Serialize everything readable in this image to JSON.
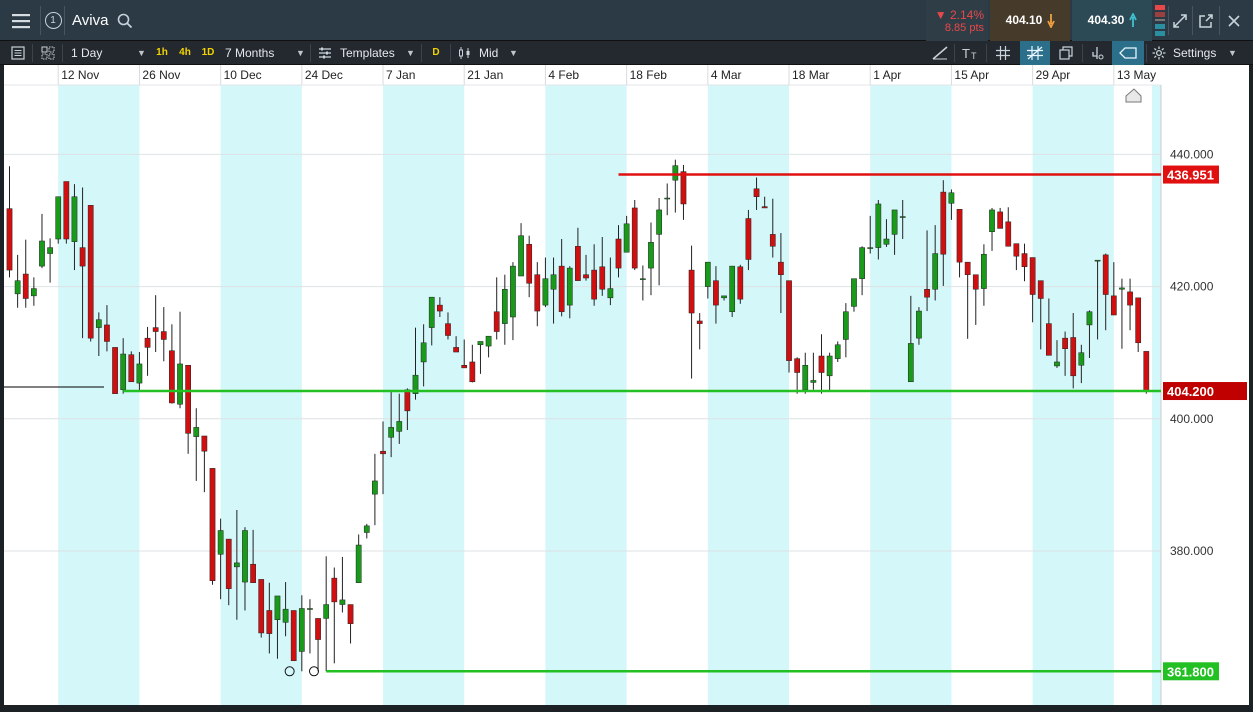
{
  "header": {
    "menu_icon": "hamburger-menu-icon",
    "account_number": "1",
    "instrument": "Aviva",
    "search_icon": "search-icon",
    "change_pct": "▼ 2.14%",
    "change_pts": "8.85 pts",
    "sell_price": "404.10",
    "buy_price": "404.30",
    "controls": [
      "expand-icon",
      "popout-icon",
      "close-icon"
    ]
  },
  "toolbar": {
    "interval": "1 Day",
    "quick_intervals": [
      "1h",
      "4h",
      "1D"
    ],
    "range": "7 Months",
    "templates": "Templates",
    "chart_type_badge": "D",
    "price_mode": "Mid",
    "drawing_label_icon": "text-size-icon",
    "settings": "Settings"
  },
  "chart_data": {
    "type": "candlestick",
    "instrument": "Aviva",
    "interval": "1 Day",
    "x_tick_labels": [
      "12 Nov",
      "26 Nov",
      "10 Dec",
      "24 Dec",
      "7 Jan",
      "21 Jan",
      "4 Feb",
      "18 Feb",
      "4 Mar",
      "18 Mar",
      "1 Apr",
      "15 Apr",
      "29 Apr",
      "13 May"
    ],
    "y_tick_labels": [
      "440.000",
      "420.000",
      "400.000",
      "380.000"
    ],
    "y_ticks": [
      440,
      420,
      400,
      380
    ],
    "ylim": [
      356.7,
      450.5
    ],
    "grid": true,
    "alternating_week_shading": true,
    "current_price": 404.2,
    "current_price_label": "404.200",
    "horizontal_lines": [
      {
        "label": "436.951",
        "value": 436.951,
        "color": "#e01010",
        "start_index": 75
      },
      {
        "label": "404.200",
        "value": 404.2,
        "color": "#22c022",
        "start_index": 14
      },
      {
        "label": "361.800",
        "value": 361.8,
        "color": "#22c022",
        "start_index": 39
      }
    ],
    "ohlc": [
      [
        431.8,
        438.2,
        421.4,
        422.5
      ],
      [
        418.9,
        424.8,
        416.8,
        420.9
      ],
      [
        421.9,
        427.1,
        416.8,
        418.2
      ],
      [
        418.6,
        421.4,
        417.1,
        419.7
      ],
      [
        423.1,
        431.0,
        422.8,
        426.9
      ],
      [
        425.0,
        427.3,
        420.6,
        425.9
      ],
      [
        427.2,
        433.6,
        426.5,
        433.6
      ],
      [
        435.9,
        435.9,
        426.5,
        427.2
      ],
      [
        426.8,
        435.5,
        422.5,
        433.6
      ],
      [
        425.9,
        435.0,
        412.2,
        423.1
      ],
      [
        432.3,
        432.3,
        411.7,
        412.2
      ],
      [
        413.8,
        416.1,
        409.5,
        415.0
      ],
      [
        414.2,
        417.2,
        410.2,
        411.7
      ],
      [
        410.8,
        410.8,
        404.4,
        403.8
      ],
      [
        404.4,
        412.2,
        403.8,
        409.8
      ],
      [
        409.7,
        410.2,
        405.6,
        405.6
      ],
      [
        405.4,
        410.1,
        404.1,
        408.3
      ],
      [
        412.2,
        413.9,
        406.5,
        410.8
      ],
      [
        413.8,
        418.7,
        410.1,
        413.2
      ],
      [
        413.2,
        416.9,
        408.7,
        412.0
      ],
      [
        410.3,
        414.3,
        402.3,
        402.4
      ],
      [
        402.2,
        416.2,
        401.6,
        408.3
      ],
      [
        408.1,
        408.1,
        394.7,
        397.8
      ],
      [
        397.3,
        401.6,
        390.6,
        398.7
      ],
      [
        397.4,
        397.4,
        388.9,
        395.1
      ],
      [
        392.5,
        392.5,
        374.9,
        375.5
      ],
      [
        379.5,
        384.9,
        372.7,
        383.1
      ],
      [
        381.8,
        381.8,
        371.8,
        374.3
      ],
      [
        377.6,
        386.2,
        369.6,
        378.2
      ],
      [
        375.3,
        383.6,
        371.0,
        383.1
      ],
      [
        378.0,
        383.2,
        375.5,
        375.2
      ],
      [
        375.7,
        375.7,
        366.9,
        367.6
      ],
      [
        371.0,
        375.2,
        364.5,
        367.5
      ],
      [
        369.6,
        373.1,
        363.7,
        373.2
      ],
      [
        369.2,
        375.3,
        367.1,
        371.2
      ],
      [
        371.0,
        371.0,
        364.7,
        363.4
      ],
      [
        364.8,
        373.3,
        361.8,
        371.3
      ],
      [
        371.2,
        372.7,
        364.5,
        371.3
      ],
      [
        369.8,
        369.8,
        361.8,
        366.6
      ],
      [
        369.8,
        379.2,
        361.8,
        371.9
      ],
      [
        375.9,
        377.5,
        363.0,
        372.3
      ],
      [
        371.9,
        379.1,
        370.7,
        372.6
      ],
      [
        371.9,
        371.9,
        366.0,
        369.0
      ],
      [
        375.2,
        382.5,
        375.2,
        380.9
      ],
      [
        382.8,
        384.1,
        381.9,
        383.8
      ],
      [
        388.6,
        394.7,
        383.9,
        390.6
      ],
      [
        395.1,
        399.6,
        388.6,
        394.7
      ],
      [
        397.2,
        404.1,
        394.2,
        398.7
      ],
      [
        398.1,
        403.8,
        396.2,
        399.6
      ],
      [
        404.4,
        404.6,
        398.3,
        401.2
      ],
      [
        403.8,
        413.8,
        402.9,
        406.6
      ],
      [
        408.6,
        414.3,
        404.9,
        411.5
      ],
      [
        413.8,
        418.4,
        411.1,
        418.4
      ],
      [
        417.2,
        418.4,
        415.4,
        416.3
      ],
      [
        414.4,
        416.1,
        412.0,
        412.6
      ],
      [
        410.8,
        412.5,
        410.1,
        410.1
      ],
      [
        408.1,
        412.0,
        408.1,
        407.7
      ],
      [
        408.6,
        411.2,
        405.5,
        405.6
      ],
      [
        411.2,
        411.2,
        406.8,
        411.7
      ],
      [
        411.0,
        412.5,
        409.3,
        412.5
      ],
      [
        416.2,
        421.4,
        412.0,
        413.2
      ],
      [
        414.4,
        421.8,
        411.2,
        419.6
      ],
      [
        415.4,
        423.7,
        411.9,
        423.1
      ],
      [
        421.6,
        429.6,
        421.6,
        427.7
      ],
      [
        426.4,
        427.7,
        418.4,
        420.5
      ],
      [
        421.8,
        423.7,
        414.0,
        416.3
      ],
      [
        417.2,
        424.4,
        416.9,
        421.2
      ],
      [
        419.6,
        424.4,
        414.4,
        421.8
      ],
      [
        423.1,
        427.2,
        415.5,
        416.2
      ],
      [
        417.2,
        423.1,
        415.2,
        422.8
      ],
      [
        426.1,
        428.9,
        421.4,
        420.9
      ],
      [
        421.8,
        424.8,
        420.9,
        421.3
      ],
      [
        422.5,
        426.4,
        417.1,
        418.1
      ],
      [
        423.0,
        427.5,
        418.6,
        419.6
      ],
      [
        418.3,
        424.4,
        417.2,
        419.7
      ],
      [
        427.2,
        429.3,
        421.4,
        422.8
      ],
      [
        425.2,
        430.7,
        425.2,
        429.5
      ],
      [
        431.9,
        433.1,
        422.5,
        422.8
      ],
      [
        421.2,
        423.2,
        417.9,
        421.2
      ],
      [
        422.8,
        429.7,
        418.7,
        426.7
      ],
      [
        427.9,
        433.4,
        420.2,
        431.6
      ],
      [
        433.4,
        435.6,
        430.8,
        433.4
      ],
      [
        436.1,
        439.2,
        431.2,
        438.3
      ],
      [
        437.4,
        438.4,
        430.1,
        432.5
      ],
      [
        422.5,
        426.2,
        406.1,
        416.0
      ],
      [
        414.8,
        416.0,
        410.5,
        414.4
      ],
      [
        420.0,
        423.1,
        418.2,
        423.7
      ],
      [
        420.9,
        423.1,
        414.4,
        417.2
      ],
      [
        418.3,
        418.3,
        417.9,
        418.6
      ],
      [
        416.2,
        420.9,
        415.4,
        423.1
      ],
      [
        423.0,
        423.3,
        417.4,
        418.1
      ],
      [
        430.3,
        431.6,
        422.5,
        424.1
      ],
      [
        434.8,
        436.5,
        431.6,
        433.6
      ],
      [
        432.1,
        433.6,
        431.9,
        431.9
      ],
      [
        427.9,
        433.3,
        424.4,
        426.1
      ],
      [
        423.7,
        428.1,
        416.0,
        421.8
      ],
      [
        420.9,
        420.9,
        407.0,
        408.8
      ],
      [
        409.1,
        409.3,
        403.8,
        407.0
      ],
      [
        404.4,
        410.0,
        403.8,
        408.1
      ],
      [
        405.5,
        410.0,
        404.4,
        405.8
      ],
      [
        409.5,
        412.8,
        403.8,
        407.0
      ],
      [
        406.5,
        410.0,
        404.1,
        409.5
      ],
      [
        409.1,
        411.7,
        408.6,
        411.2
      ],
      [
        412.0,
        417.5,
        409.3,
        416.2
      ],
      [
        417.0,
        420.9,
        416.2,
        421.2
      ],
      [
        421.2,
        426.1,
        418.7,
        425.9
      ],
      [
        425.9,
        430.7,
        425.0,
        425.9
      ],
      [
        425.9,
        433.1,
        424.1,
        432.5
      ],
      [
        426.4,
        430.2,
        426.0,
        427.2
      ],
      [
        427.9,
        430.8,
        424.8,
        431.6
      ],
      [
        430.6,
        433.1,
        427.2,
        430.6
      ],
      [
        405.6,
        418.6,
        405.6,
        411.4
      ],
      [
        412.2,
        416.9,
        411.2,
        416.3
      ],
      [
        419.6,
        428.5,
        416.3,
        418.4
      ],
      [
        419.6,
        429.3,
        417.9,
        425.0
      ],
      [
        434.3,
        436.1,
        420.1,
        424.9
      ],
      [
        432.6,
        434.7,
        430.1,
        434.2
      ],
      [
        431.7,
        431.7,
        421.4,
        423.7
      ],
      [
        423.7,
        423.7,
        412.1,
        421.8
      ],
      [
        421.8,
        421.8,
        414.2,
        419.6
      ],
      [
        419.7,
        426.4,
        417.1,
        424.9
      ],
      [
        428.3,
        431.9,
        425.4,
        431.6
      ],
      [
        431.3,
        431.9,
        429.8,
        428.8
      ],
      [
        429.8,
        432.0,
        428.7,
        426.1
      ],
      [
        426.5,
        426.5,
        422.5,
        424.6
      ],
      [
        425.0,
        426.5,
        420.8,
        423.0
      ],
      [
        424.4,
        424.4,
        414.6,
        418.8
      ],
      [
        420.9,
        420.9,
        410.5,
        418.2
      ],
      [
        414.4,
        418.2,
        411.1,
        409.6
      ],
      [
        408.0,
        411.9,
        407.7,
        408.6
      ],
      [
        412.2,
        413.2,
        406.5,
        410.6
      ],
      [
        412.3,
        416.0,
        404.6,
        406.5
      ],
      [
        408.1,
        411.2,
        405.4,
        410.0
      ],
      [
        414.2,
        416.4,
        409.2,
        416.2
      ],
      [
        424.0,
        424.0,
        412.0,
        424.0
      ],
      [
        424.8,
        425.0,
        413.4,
        418.8
      ],
      [
        418.6,
        423.7,
        416.9,
        415.7
      ],
      [
        419.6,
        421.2,
        410.6,
        419.8
      ],
      [
        419.2,
        421.2,
        413.4,
        417.2
      ],
      [
        418.3,
        418.3,
        410.1,
        411.5
      ],
      [
        410.2,
        410.2,
        403.8,
        404.2
      ]
    ]
  }
}
